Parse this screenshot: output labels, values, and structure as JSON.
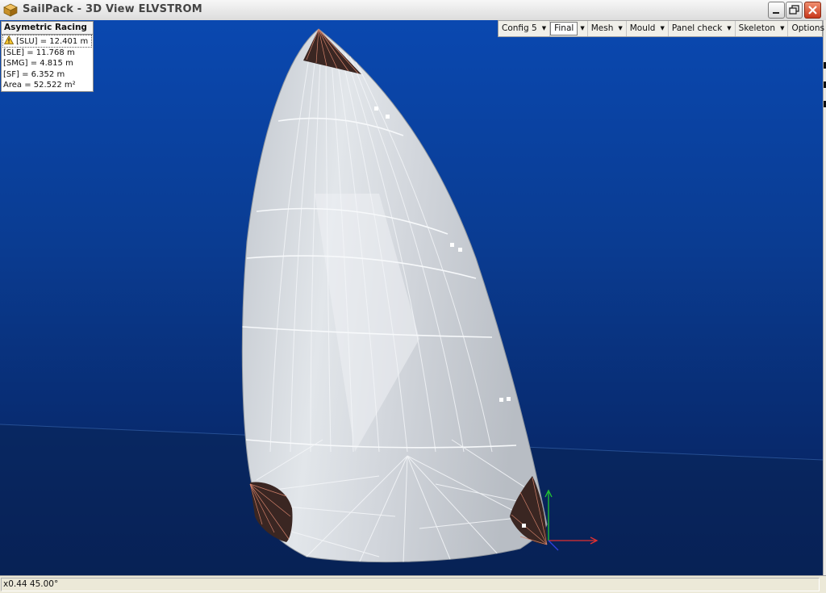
{
  "window": {
    "title": "SailPack - 3D View  ELVSTROM",
    "controls": {
      "minimize": "minimize",
      "maximize": "restore",
      "close": "close"
    }
  },
  "info_panel": {
    "title": "Asymetric Racing",
    "rows": [
      "[SLU] = 12.401 m",
      "[SLE] = 11.768 m",
      "[SMG] = 4.815 m",
      "[SF] = 6.352 m",
      "Area = 52.522 m²"
    ],
    "warning_row_index": 0
  },
  "toolbar": {
    "items": [
      {
        "label": "Config 5"
      },
      {
        "label": "Final",
        "selected": true
      },
      {
        "label": "Mesh"
      },
      {
        "label": "Mould"
      },
      {
        "label": "Panel check"
      },
      {
        "label": "Skeleton"
      },
      {
        "label": "Options"
      }
    ]
  },
  "status": {
    "text": "x0.44 45.00°"
  },
  "colors": {
    "sky_top": "#0a48b0",
    "sky_bottom": "#061e55",
    "sail": "#d3d7dc",
    "seam": "#f2f4f7",
    "patch_fill": "#3a2622",
    "patch_lines": "#d0806a",
    "axis_x": "#e03030",
    "axis_y": "#22c830",
    "axis_z": "#3040e0"
  },
  "icons": [
    "app-cube-icon",
    "warning-icon",
    "chevron-down-icon",
    "minimize-icon",
    "restore-icon",
    "close-icon"
  ]
}
